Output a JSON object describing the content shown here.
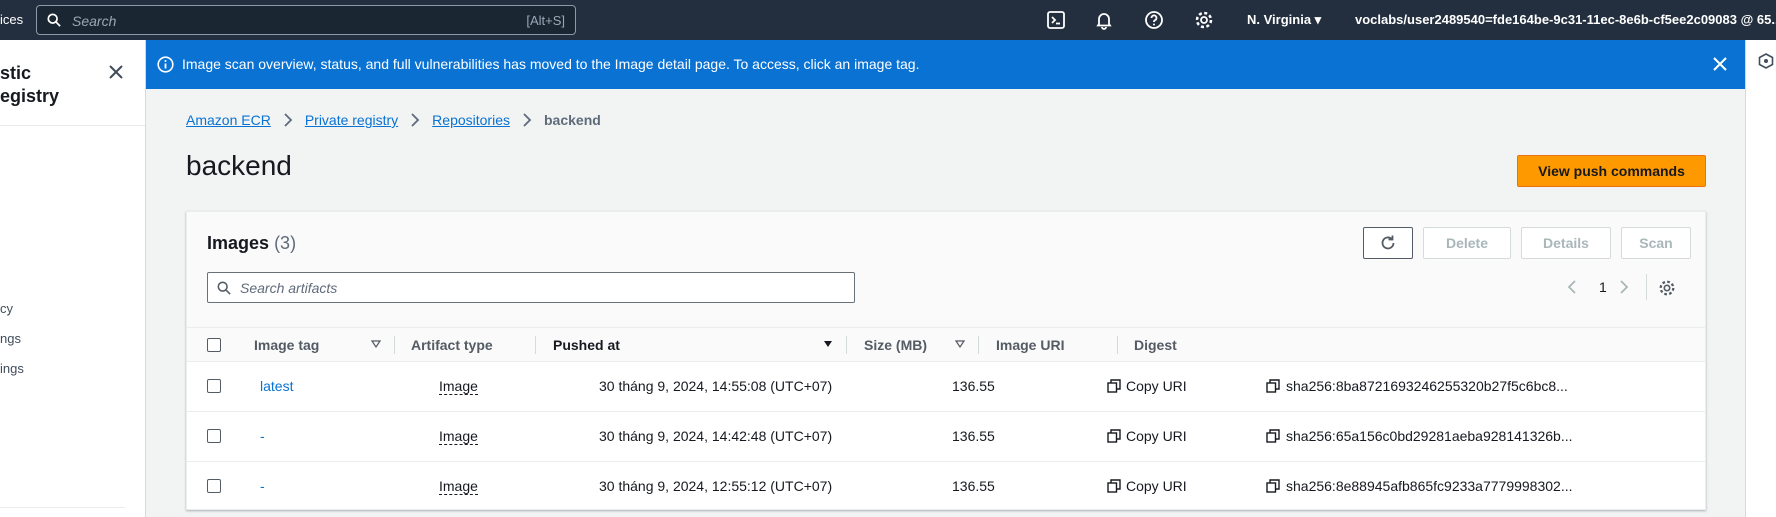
{
  "topnav": {
    "services_fragment": "ices",
    "search_placeholder": "Search",
    "search_shortcut": "[Alt+S]",
    "region": "N. Virginia ▾",
    "account": "voclabs/user2489540=fde164be-9c31-11ec-8e6b-cf5ee2c09083 @ 65... ▾"
  },
  "sidepanel": {
    "title": "stic\negistry",
    "links": [
      "cy",
      "ngs",
      "ings"
    ]
  },
  "flash": {
    "message": "Image scan overview, status, and full vulnerabilities has moved to the Image detail page. To access, click an image tag."
  },
  "breadcrumbs": {
    "items": [
      "Amazon ECR",
      "Private registry",
      "Repositories"
    ],
    "current": "backend"
  },
  "page": {
    "title": "backend",
    "push_label": "View push commands"
  },
  "images": {
    "title": "Images",
    "count": "(3)",
    "buttons": {
      "delete": "Delete",
      "details": "Details",
      "scan": "Scan"
    },
    "search_placeholder": "Search artifacts",
    "page_number": "1",
    "columns": {
      "tag": "Image tag",
      "type": "Artifact type",
      "pushed": "Pushed at",
      "size": "Size (MB)",
      "uri": "Image URI",
      "digest": "Digest"
    },
    "rows": [
      {
        "tag": "latest",
        "type": "Image",
        "pushed": "30 tháng 9, 2024, 14:55:08 (UTC+07)",
        "size": "136.55",
        "uri": "Copy URI",
        "digest": "sha256:8ba8721693246255320b27f5c6bc8..."
      },
      {
        "tag": "-",
        "type": "Image",
        "pushed": "30 tháng 9, 2024, 14:42:48 (UTC+07)",
        "size": "136.55",
        "uri": "Copy URI",
        "digest": "sha256:65a156c0bd29281aeba928141326b..."
      },
      {
        "tag": "-",
        "type": "Image",
        "pushed": "30 tháng 9, 2024, 12:55:12 (UTC+07)",
        "size": "136.55",
        "uri": "Copy URI",
        "digest": "sha256:8e88945afb865fc9233a7779998302..."
      }
    ]
  },
  "colors": {
    "nav_bg": "#232f3e",
    "flash_bg": "#0972d3",
    "primary_button": "#ff9900",
    "link": "#0972d3"
  }
}
